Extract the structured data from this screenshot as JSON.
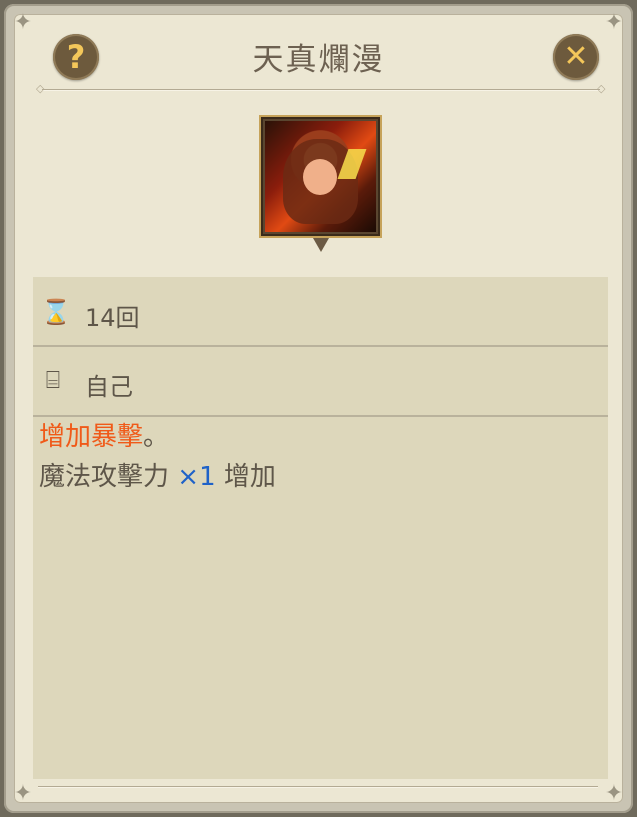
{
  "dialog": {
    "title": "天真爛漫",
    "help_icon": "question-mark-icon",
    "close_icon": "close-x-icon",
    "help_glyph": "?",
    "close_glyph": "✕"
  },
  "buff": {
    "duration_icon": "hourglass-icon",
    "duration": "14回",
    "target_icon": "target-self-icon",
    "target": "自己",
    "effect_title": "增加暴擊",
    "effect_title_suffix": "。",
    "effect_line_prefix": "魔法攻擊力",
    "effect_multiplier": "×1",
    "effect_line_suffix": "增加"
  },
  "colors": {
    "title_text": "#6d6151",
    "crit_orange": "#f05a19",
    "multiplier_blue": "#1f62c8",
    "panel_bg": "#ddd7bb"
  }
}
